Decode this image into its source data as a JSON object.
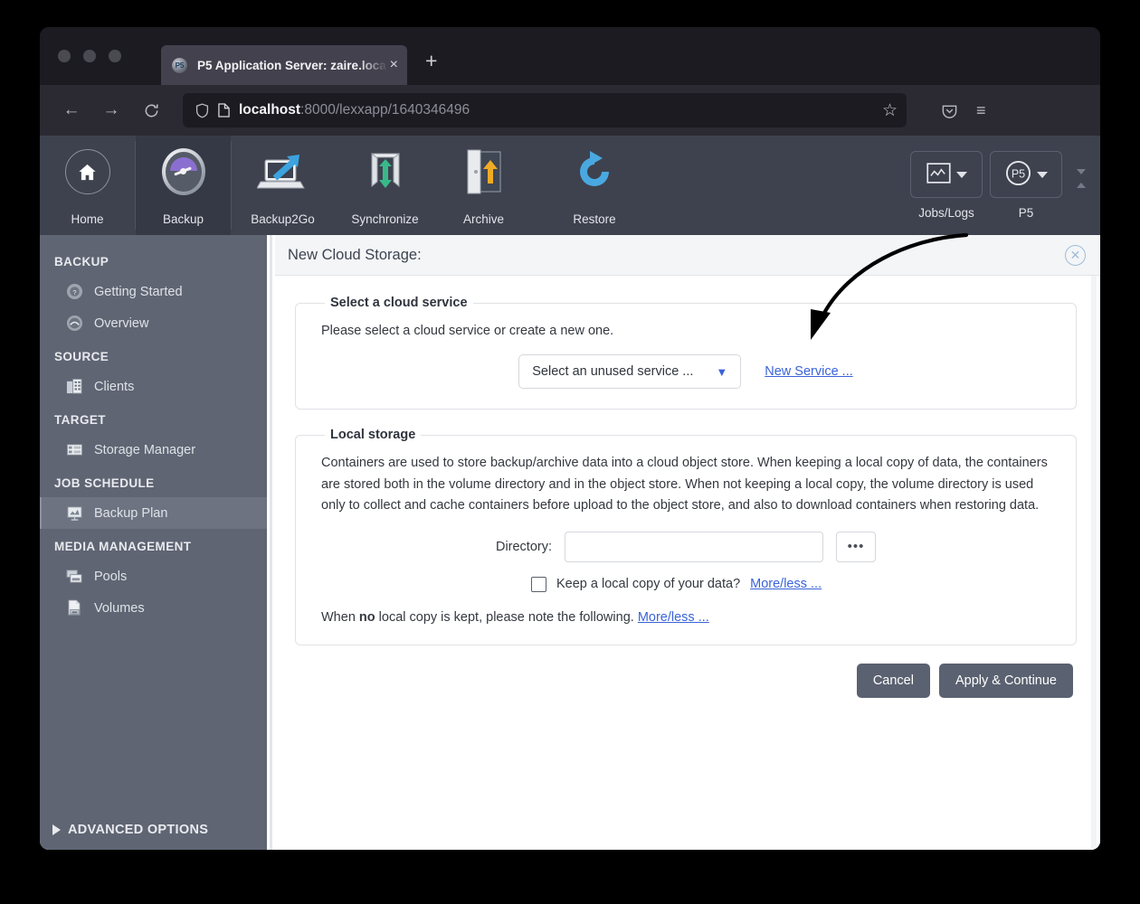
{
  "browser": {
    "tab": {
      "title": "P5 Application Server: zaire.loca",
      "favicon": "p5-favicon-icon",
      "close": "×"
    },
    "new_tab_label": "+",
    "nav": {
      "back": "←",
      "forward": "→",
      "reload": "⟳"
    },
    "url": {
      "host": "localhost",
      "path": ":8000/lexxapp/1640346496"
    },
    "star": "☆",
    "pocket": "pocket-icon",
    "menu": "≡"
  },
  "toolbar": {
    "items": [
      {
        "label": "Home",
        "icon": "home-icon",
        "active": false
      },
      {
        "label": "Backup",
        "icon": "gauge-icon",
        "active": true
      },
      {
        "label": "Backup2Go",
        "icon": "laptop-upload-icon",
        "active": false
      },
      {
        "label": "Synchronize",
        "icon": "sync-arrows-icon",
        "active": false
      },
      {
        "label": "Archive",
        "icon": "archive-door-icon",
        "active": false
      },
      {
        "label": "Restore",
        "icon": "restore-arrow-icon",
        "active": false
      }
    ],
    "dropdowns": [
      {
        "label": "Jobs/Logs",
        "icon": "chart-window-icon"
      },
      {
        "label": "P5",
        "icon": "p5-circle-icon"
      }
    ],
    "collapse_handle": "collapse-handle-icon"
  },
  "sidebar": {
    "sections": [
      {
        "title": "BACKUP",
        "items": [
          {
            "label": "Getting Started",
            "icon": "question-disc-icon",
            "selected": false
          },
          {
            "label": "Overview",
            "icon": "overview-disc-icon",
            "selected": false
          }
        ]
      },
      {
        "title": "SOURCE",
        "items": [
          {
            "label": "Clients",
            "icon": "clients-building-icon",
            "selected": false
          }
        ]
      },
      {
        "title": "TARGET",
        "items": [
          {
            "label": "Storage Manager",
            "icon": "storage-grid-icon",
            "selected": false
          }
        ]
      },
      {
        "title": "JOB SCHEDULE",
        "items": [
          {
            "label": "Backup Plan",
            "icon": "backup-plan-icon",
            "selected": true
          }
        ]
      },
      {
        "title": "MEDIA MANAGEMENT",
        "items": [
          {
            "label": "Pools",
            "icon": "pools-tapes-icon",
            "selected": false
          },
          {
            "label": "Volumes",
            "icon": "volume-tape-icon",
            "selected": false
          }
        ]
      }
    ],
    "advanced_options": "ADVANCED OPTIONS"
  },
  "panel": {
    "title": "New Cloud Storage:",
    "close_icon": "close-circle-icon",
    "cloud_service": {
      "legend": "Select a cloud service",
      "description": "Please select a cloud service or create a new one.",
      "select_value": "Select an unused service ...",
      "new_service_link": "New Service ..."
    },
    "local_storage": {
      "legend": "Local storage",
      "description": "Containers are used to store backup/archive data into a cloud object store. When keeping a local copy of data, the containers are stored both in the volume directory and in the object store. When not keeping a local copy, the volume directory is used only to collect and cache containers before upload to the object store, and also to download containers when restoring data.",
      "directory_label": "Directory:",
      "directory_value": "",
      "browse_label": "•••",
      "keep_copy_label": "Keep a local copy of your data?",
      "keep_copy_link": "More/less ...",
      "keep_copy_checked": false,
      "note_prefix": "When ",
      "note_bold": "no",
      "note_suffix": " local copy is kept, please note the following. ",
      "note_link": "More/less ..."
    },
    "buttons": {
      "cancel": "Cancel",
      "apply": "Apply & Continue"
    }
  },
  "colors": {
    "accent_link": "#3a63d8",
    "toolbar_bg": "#3d424e",
    "sidebar_bg": "#5f6573",
    "button_bg": "#5a6170"
  }
}
